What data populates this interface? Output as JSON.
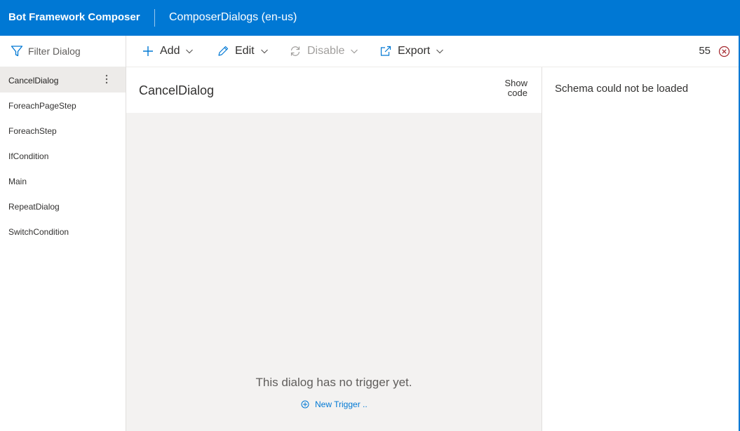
{
  "header": {
    "app_title": "Bot Framework Composer",
    "project_title": "ComposerDialogs (en-us)",
    "brand_color": "#0078d4"
  },
  "sidebar": {
    "filter_label": "Filter Dialog",
    "filter_icon": "filter-icon",
    "dialogs": [
      {
        "label": "CancelDialog",
        "selected": true
      },
      {
        "label": "ForeachPageStep"
      },
      {
        "label": "ForeachStep"
      },
      {
        "label": "IfCondition"
      },
      {
        "label": "Main"
      },
      {
        "label": "RepeatDialog"
      },
      {
        "label": "SwitchCondition"
      }
    ]
  },
  "toolbar": {
    "add_label": "Add",
    "edit_label": "Edit",
    "disable_label": "Disable",
    "export_label": "Export",
    "error_count": "55",
    "error_color": "#a4262c"
  },
  "editor": {
    "title": "CancelDialog",
    "show_code_label": "Show code",
    "empty_message": "This dialog has no trigger yet.",
    "new_trigger_label": "New Trigger .."
  },
  "property_panel": {
    "message": "Schema could not be loaded"
  }
}
